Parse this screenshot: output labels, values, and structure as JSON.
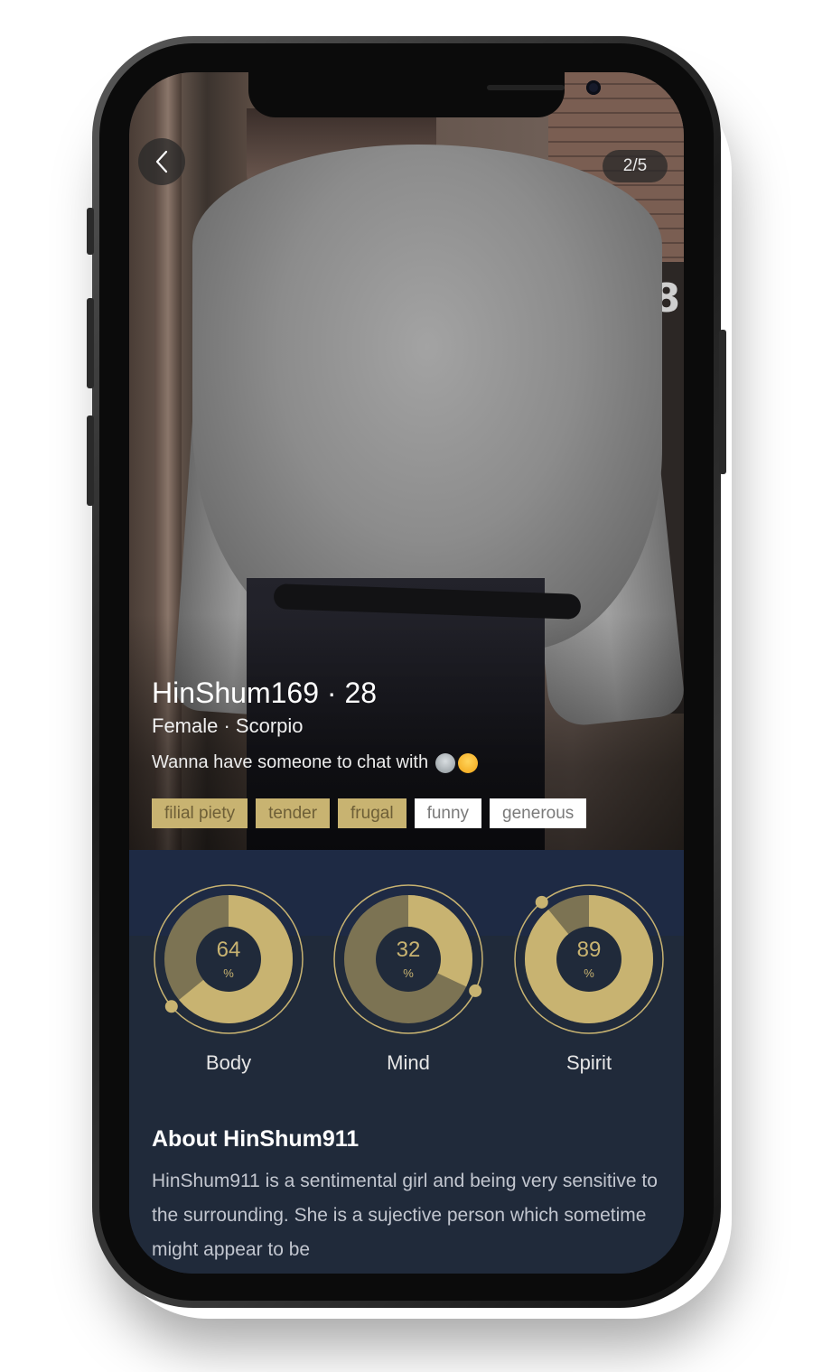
{
  "profile": {
    "name_age": "HinShum169 · 28",
    "gender_sign": "Female · Scorpio",
    "status": "Wanna have someone to chat with",
    "status_emojis": [
      "alien-emoji",
      "grimacing-emoji"
    ],
    "pager": "2/5",
    "tags": [
      {
        "label": "filial piety",
        "style": "gold"
      },
      {
        "label": "tender",
        "style": "gold"
      },
      {
        "label": "frugal",
        "style": "gold"
      },
      {
        "label": "funny",
        "style": "white"
      },
      {
        "label": "generous",
        "style": "white"
      }
    ]
  },
  "stats": [
    {
      "label": "Body",
      "value": "64",
      "unit": "%",
      "fraction": 0.64
    },
    {
      "label": "Mind",
      "value": "32",
      "unit": "%",
      "fraction": 0.32
    },
    {
      "label": "Spirit",
      "value": "89",
      "unit": "%",
      "fraction": 0.89
    }
  ],
  "about": {
    "title": "About HinShum911",
    "body": "HinShum911 is a sentimental girl and being very sensitive to the surrounding. She is a sujective person which sometime might appear to be"
  },
  "colors": {
    "accent_gold": "#c8b371",
    "panel_bg": "#202a3a"
  },
  "icons": {
    "back": "chevron-left-icon"
  }
}
